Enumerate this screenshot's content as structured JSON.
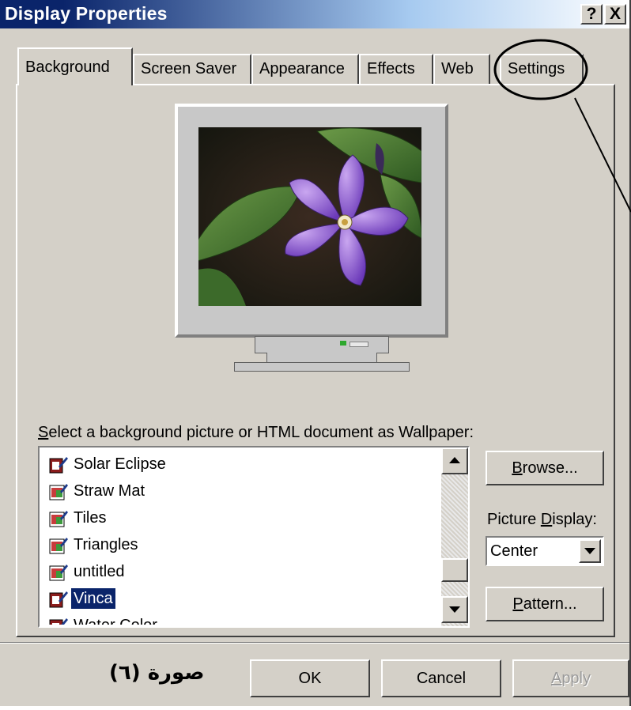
{
  "window": {
    "title": "Display Properties",
    "help_button": "?",
    "close_button": "X"
  },
  "tabs": [
    {
      "label": "Background",
      "active": true
    },
    {
      "label": "Screen Saver"
    },
    {
      "label": "Appearance"
    },
    {
      "label": "Effects"
    },
    {
      "label": "Web"
    },
    {
      "label": "Settings"
    }
  ],
  "wallpaper": {
    "label_prefix_underlined": "S",
    "label_rest": "elect a background picture or HTML document as Wallpaper:",
    "items": [
      {
        "name": "Solar Eclipse",
        "icon": "paint-document-icon"
      },
      {
        "name": "Straw Mat",
        "icon": "image-document-icon"
      },
      {
        "name": "Tiles",
        "icon": "image-document-icon"
      },
      {
        "name": "Triangles",
        "icon": "image-document-icon"
      },
      {
        "name": "untitled",
        "icon": "image-document-icon"
      },
      {
        "name": "Vinca",
        "icon": "paint-document-icon",
        "selected": true
      },
      {
        "name": "Water Color",
        "icon": "paint-document-icon"
      }
    ]
  },
  "buttons": {
    "browse_u": "B",
    "browse_rest": "rowse...",
    "pattern_u": "P",
    "pattern_rest": "attern...",
    "ok": "OK",
    "cancel": "Cancel",
    "apply_u": "A",
    "apply_rest": "pply"
  },
  "picture_display": {
    "label_before": "Picture ",
    "label_u": "D",
    "label_after": "isplay:",
    "value": "Center"
  },
  "caption": "صورة (٦)",
  "colors": {
    "title_bar": "#0a246a",
    "face": "#d4d0c8",
    "selection": "#0a246a",
    "annotation": "#000000"
  }
}
